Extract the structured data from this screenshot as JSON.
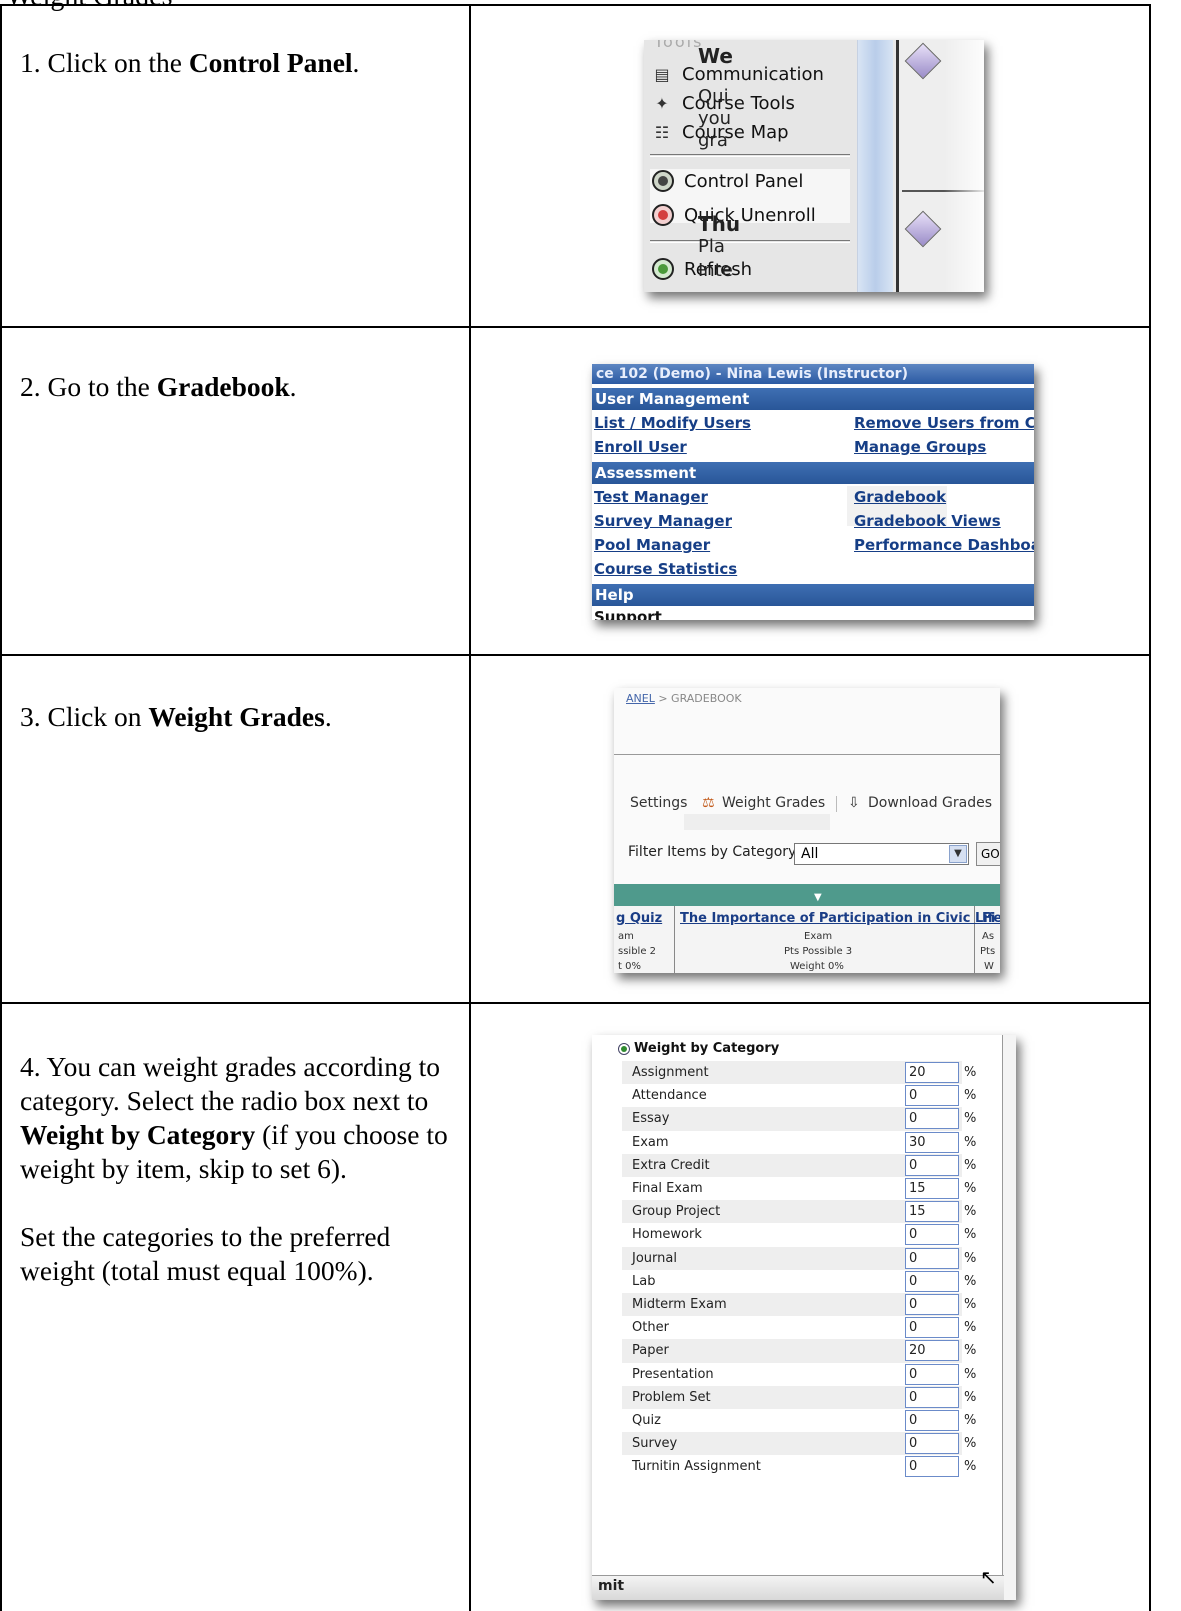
{
  "heading_fragment": "Weight Grades",
  "steps": [
    {
      "number": "1.",
      "pre": "Click on the",
      "bold": "Control Panel",
      "post": "."
    },
    {
      "number": "2.",
      "pre": "Go to the",
      "bold": "Gradebook",
      "post": "."
    },
    {
      "number": "3.",
      "pre": "Click on",
      "bold": "Weight Grades",
      "post": "."
    },
    {
      "number": "4.",
      "pre": "You can weight grades according to category. Select the radio box next to",
      "bold": "Weight by Category",
      "post": "(if you choose to weight by item, skip to set 6).",
      "para2": "Set the categories to the preferred weight (total must equal 100%)."
    }
  ],
  "shot1": {
    "tools_label": "Tools",
    "items": [
      "Communication",
      "Course Tools",
      "Course Map",
      "Control Panel",
      "Quick Unenroll",
      "Refresh"
    ],
    "right_fragments": [
      "We",
      "Qui",
      "you",
      "gra",
      "Thu",
      "Pla",
      "Inte"
    ]
  },
  "shot2": {
    "title": "ce 102 (Demo) - Nina Lewis (Instructor)",
    "sections": {
      "user_management": "User Management",
      "assessment": "Assessment",
      "help": "Help"
    },
    "links": {
      "list_modify_users": "List / Modify Users",
      "remove_users": "Remove Users from Cou",
      "enroll_user": "Enroll User",
      "manage_groups": "Manage Groups",
      "test_manager": "Test Manager",
      "gradebook": "Gradebook",
      "survey_manager": "Survey Manager",
      "gradebook_views": "Gradebook Views",
      "pool_manager": "Pool Manager",
      "performance_dashboard": "Performance Dashboard",
      "course_statistics": "Course Statistics"
    },
    "support": "Support"
  },
  "shot3": {
    "breadcrumb_link": "ANEL",
    "breadcrumb_rest": " > GRADEBOOK",
    "settings": "Settings",
    "weight_grades": "Weight Grades",
    "download_grades": "Download Grades",
    "filter_label": "Filter Items by Category",
    "filter_value": "All",
    "go": "GO",
    "col_left_title": "g Quiz",
    "col_left_lines": [
      "am",
      "ssible 2",
      "t 0%"
    ],
    "col_mid_title": "The Importance of Participation in Civic Life",
    "col_mid_lines": [
      "Exam",
      "Pts Possible 3",
      "Weight 0%"
    ],
    "col_right_title": "Fi",
    "col_right_lines": [
      "As",
      "Pts",
      "W"
    ]
  },
  "shot4": {
    "heading": "Weight by Category",
    "percent_sign": "%",
    "submit": "mit",
    "categories": [
      {
        "label": "Assignment",
        "value": "20"
      },
      {
        "label": "Attendance",
        "value": "0"
      },
      {
        "label": "Essay",
        "value": "0"
      },
      {
        "label": "Exam",
        "value": "30"
      },
      {
        "label": "Extra Credit",
        "value": "0"
      },
      {
        "label": "Final Exam",
        "value": "15"
      },
      {
        "label": "Group Project",
        "value": "15"
      },
      {
        "label": "Homework",
        "value": "0"
      },
      {
        "label": "Journal",
        "value": "0"
      },
      {
        "label": "Lab",
        "value": "0"
      },
      {
        "label": "Midterm Exam",
        "value": "0"
      },
      {
        "label": "Other",
        "value": "0"
      },
      {
        "label": "Paper",
        "value": "20"
      },
      {
        "label": "Presentation",
        "value": "0"
      },
      {
        "label": "Problem Set",
        "value": "0"
      },
      {
        "label": "Quiz",
        "value": "0"
      },
      {
        "label": "Survey",
        "value": "0"
      },
      {
        "label": "Turnitin Assignment",
        "value": "0"
      }
    ]
  }
}
